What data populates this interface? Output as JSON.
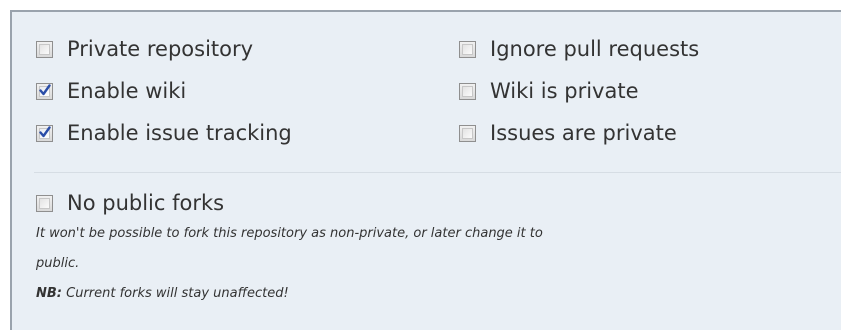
{
  "options": {
    "private_repository": {
      "label": "Private repository",
      "checked": false
    },
    "ignore_pull_requests": {
      "label": "Ignore pull requests",
      "checked": false
    },
    "enable_wiki": {
      "label": "Enable wiki",
      "checked": true
    },
    "wiki_is_private": {
      "label": "Wiki is private",
      "checked": false
    },
    "enable_issue_tracking": {
      "label": "Enable issue tracking",
      "checked": true
    },
    "issues_are_private": {
      "label": "Issues are private",
      "checked": false
    },
    "no_public_forks": {
      "label": "No public forks",
      "checked": false
    }
  },
  "forks_help": {
    "line1": "It won't be possible to fork this repository as non-private, or later change it to",
    "line2": "public.",
    "nb_label": "NB:",
    "nb_text": " Current forks will stay unaffected!"
  },
  "colors": {
    "panel_bg": "#e9eff5",
    "check_mark": "#2b4ea8"
  }
}
